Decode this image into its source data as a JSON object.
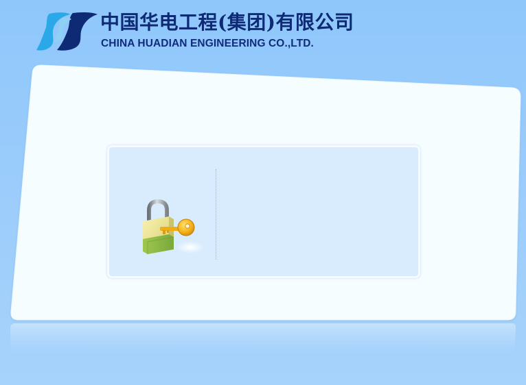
{
  "header": {
    "company_name_cn": "中国华电工程(集团)有限公司",
    "company_name_en": "CHINA HUADIAN ENGINEERING CO.,LTD.",
    "logo_icon": "huadian-logo-icon"
  },
  "login": {
    "lock_icon": "padlock-key-icon"
  },
  "colors": {
    "background": "#9dcdfb",
    "panel": "#f5fdff",
    "login_box": "#d9ecfd",
    "logo_dark": "#0e2a75",
    "logo_light": "#2aa8e8"
  }
}
